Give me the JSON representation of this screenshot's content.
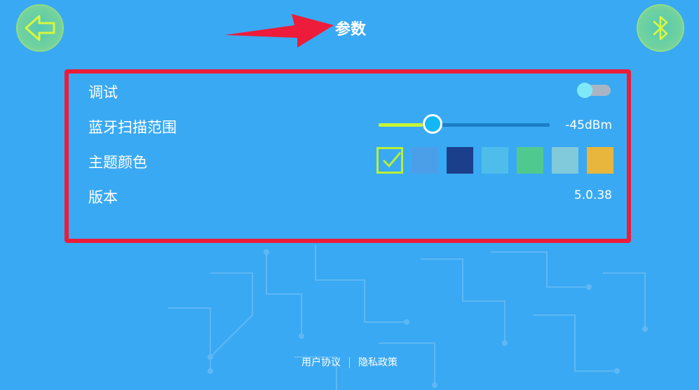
{
  "header": {
    "title": "参数",
    "back_icon": "back-arrow-icon",
    "bluetooth_icon": "bluetooth-icon"
  },
  "settings": {
    "debug": {
      "label": "调试",
      "enabled": false
    },
    "scan_range": {
      "label": "蓝牙扫描范围",
      "value_text": "-45dBm",
      "fraction": 0.26
    },
    "theme": {
      "label": "主题颜色",
      "colors": [
        "#3aa9f3",
        "#4b9fe8",
        "#1b3f8b",
        "#4fbdea",
        "#50c98f",
        "#80cadb",
        "#e8b63c"
      ],
      "selected_index": 0
    },
    "version": {
      "label": "版本",
      "value": "5.0.38"
    }
  },
  "footer": {
    "user_agreement": "用户协议",
    "privacy_policy": "隐私政策"
  },
  "annotation_color": "#ec1c3a"
}
